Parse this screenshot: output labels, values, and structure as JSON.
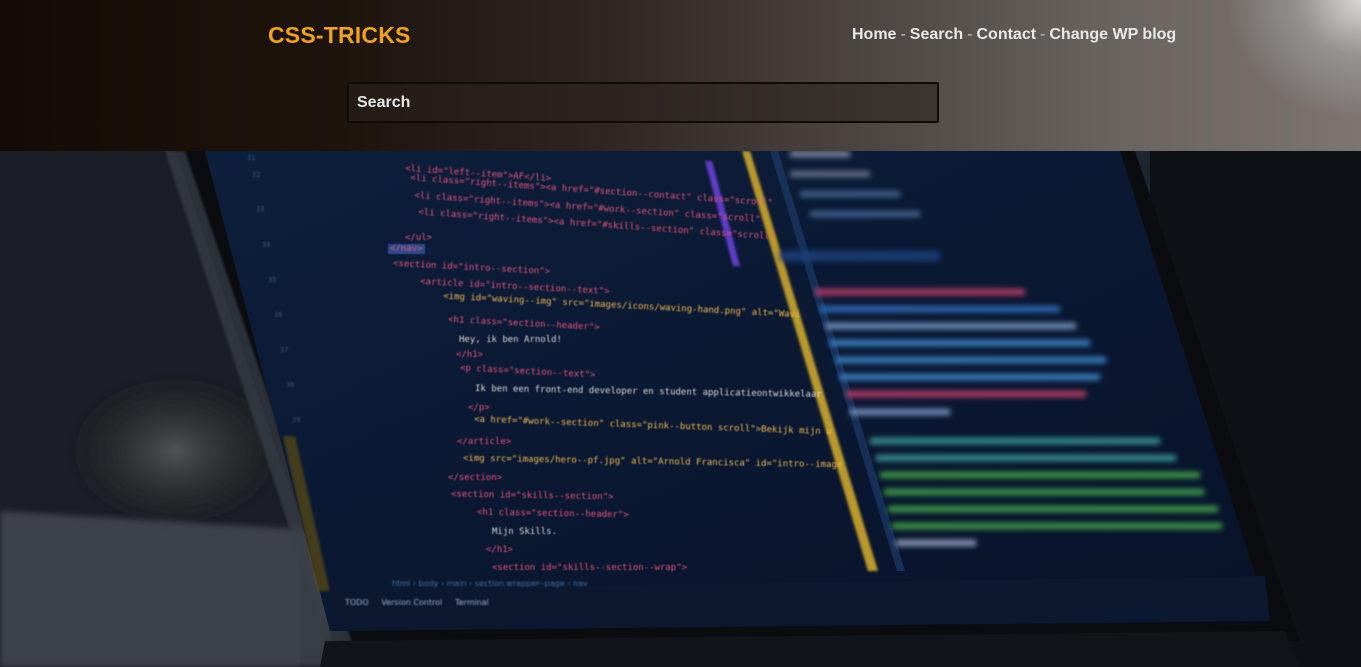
{
  "header": {
    "logo": "CSS-TRICKS",
    "nav": [
      {
        "label": "Home"
      },
      {
        "label": "Search"
      },
      {
        "label": "Contact"
      },
      {
        "label": "Change WP blog"
      }
    ],
    "nav_separator": "-",
    "search": {
      "placeholder": "Search",
      "value": ""
    }
  },
  "hero": {
    "code_lines": [
      "<li id=\"left--item\">AF</li>",
      "<li class=\"right--items\"><a href=\"#section--contact\" class=\"scroll\"",
      "<li class=\"right--items\"><a href=\"#work--section\" class=\"scroll\"",
      "<li class=\"right--items\"><a href=\"#skills--section\" class=\"scroll\"",
      "</ul>",
      "</nav>",
      "<section id=\"intro--section\">",
      "<article id=\"intro--section--text\">",
      "<img id=\"waving--img\" src=\"images/icons/waving-hand.png\" alt=\"Wavi",
      "<h1 class=\"section--header\">",
      "Hey, ik ben Arnold!",
      "</h1>",
      "<p class=\"section--text\">",
      "Ik ben een front-end developer en student applicatieontwikkelaar",
      "</p>",
      "<a href=\"#work--section\" class=\"pink--button scroll\">Bekijk mijn w",
      "</article>",
      "<img src=\"images/hero--pf.jpg\" alt=\"Arnold Francisca\" id=\"intro--image",
      "</section>",
      "<section id=\"skills--section\">",
      "<h1 class=\"section--header\">",
      "Mijn Skills.",
      "</h1>",
      "<section id=\"skills--section--wrap\">"
    ],
    "breadcrumb": [
      "html",
      "body",
      "main",
      "section.wrapper--page",
      "nav"
    ],
    "status_items": [
      "TODO",
      "Version Control",
      "Terminal"
    ]
  },
  "colors": {
    "logo": "#f1a21b",
    "nav": "#e8e8e8",
    "tag": "#e8527a",
    "attr": "#f0b74a",
    "string": "#7fd4ff",
    "text": "#d9d9d9"
  }
}
